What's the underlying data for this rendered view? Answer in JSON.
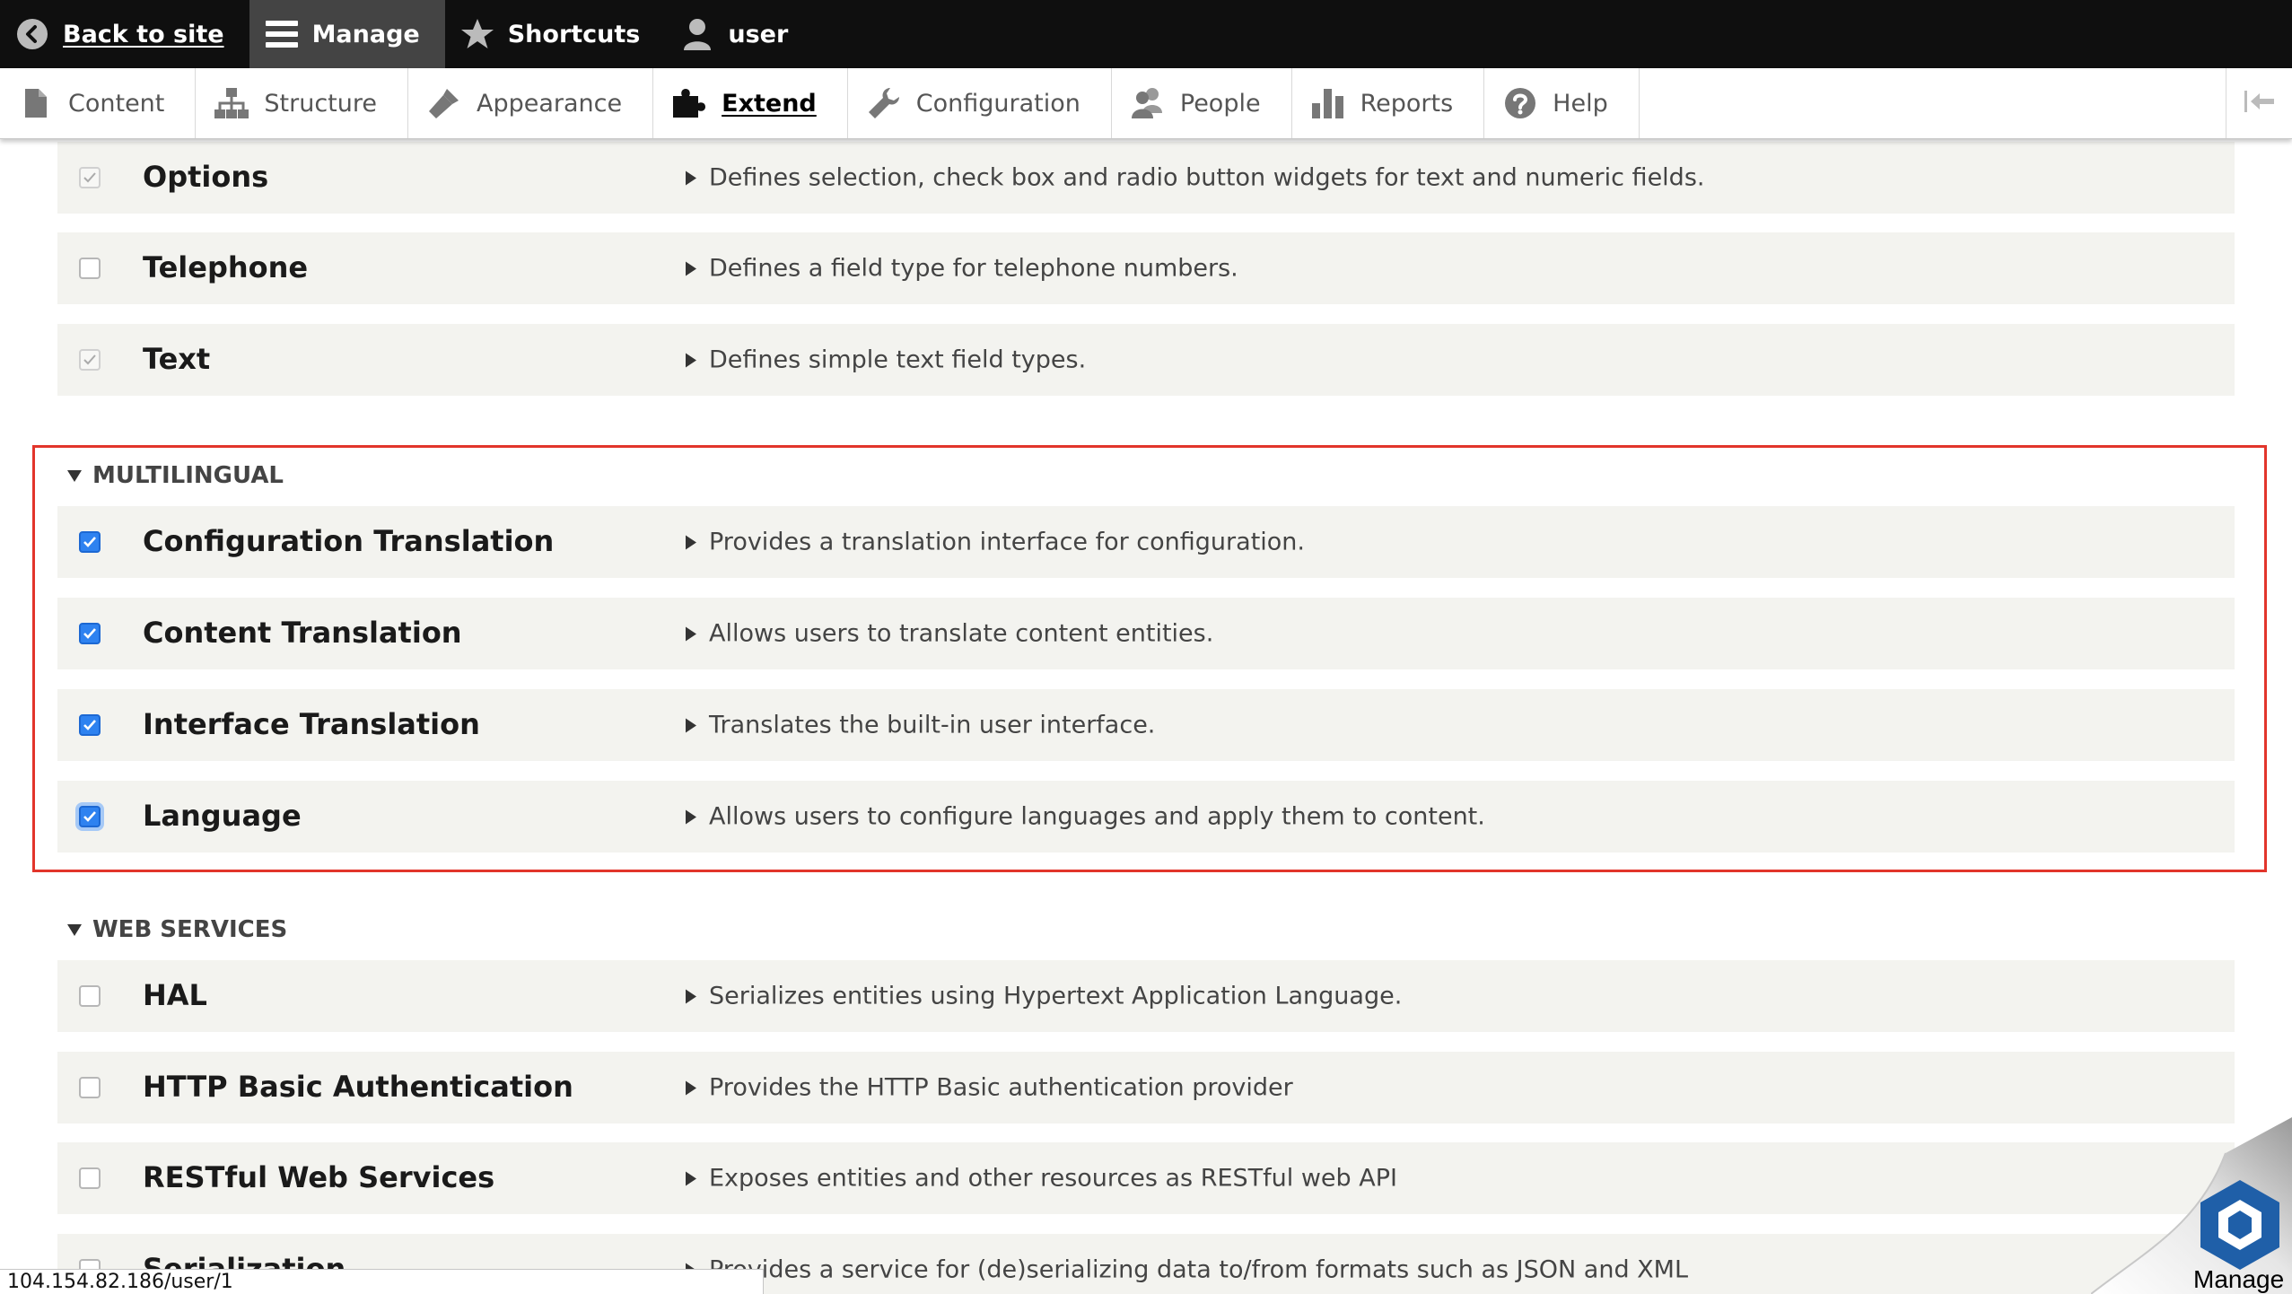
{
  "toolbar": {
    "back_to_site": "Back to site",
    "manage": "Manage",
    "shortcuts": "Shortcuts",
    "user": "user"
  },
  "tray": {
    "items": [
      {
        "label": "Content",
        "icon": "file-icon"
      },
      {
        "label": "Structure",
        "icon": "sitemap-icon"
      },
      {
        "label": "Appearance",
        "icon": "paintbrush-icon"
      },
      {
        "label": "Extend",
        "icon": "puzzle-icon",
        "active": true
      },
      {
        "label": "Configuration",
        "icon": "wrench-icon"
      },
      {
        "label": "People",
        "icon": "people-icon"
      },
      {
        "label": "Reports",
        "icon": "bar-chart-icon"
      },
      {
        "label": "Help",
        "icon": "help-icon"
      }
    ]
  },
  "modules_top": [
    {
      "name": "Options",
      "desc": "Defines selection, check box and radio button widgets for text and numeric fields.",
      "checked": true,
      "disabled": true
    },
    {
      "name": "Telephone",
      "desc": "Defines a field type for telephone numbers.",
      "checked": false,
      "disabled": false
    },
    {
      "name": "Text",
      "desc": "Defines simple text field types.",
      "checked": true,
      "disabled": true
    }
  ],
  "multilingual": {
    "heading": "MULTILINGUAL",
    "modules": [
      {
        "name": "Configuration Translation",
        "desc": "Provides a translation interface for configuration.",
        "checked": true
      },
      {
        "name": "Content Translation",
        "desc": "Allows users to translate content entities.",
        "checked": true
      },
      {
        "name": "Interface Translation",
        "desc": "Translates the built-in user interface.",
        "checked": true
      },
      {
        "name": "Language",
        "desc": "Allows users to configure languages and apply them to content.",
        "checked": true
      }
    ]
  },
  "web_services": {
    "heading": "WEB SERVICES",
    "modules": [
      {
        "name": "HAL",
        "desc": "Serializes entities using Hypertext Application Language.",
        "checked": false
      },
      {
        "name": "HTTP Basic Authentication",
        "desc": "Provides the HTTP Basic authentication provider",
        "checked": false
      },
      {
        "name": "RESTful Web Services",
        "desc": "Exposes entities and other resources as RESTful web API",
        "checked": false
      },
      {
        "name": "Serialization",
        "desc": "Provides a service for (de)serializing data to/from formats such as JSON and XML",
        "checked": false
      }
    ]
  },
  "status_bar": "104.154.82.186/user/1",
  "floating_widget_label": "Manage",
  "colors": {
    "toolbar_bg": "#0f0f0f",
    "checkbox_on": "#2e82f0",
    "highlight_border": "#e2352b",
    "row_bg": "#f3f3ef"
  }
}
